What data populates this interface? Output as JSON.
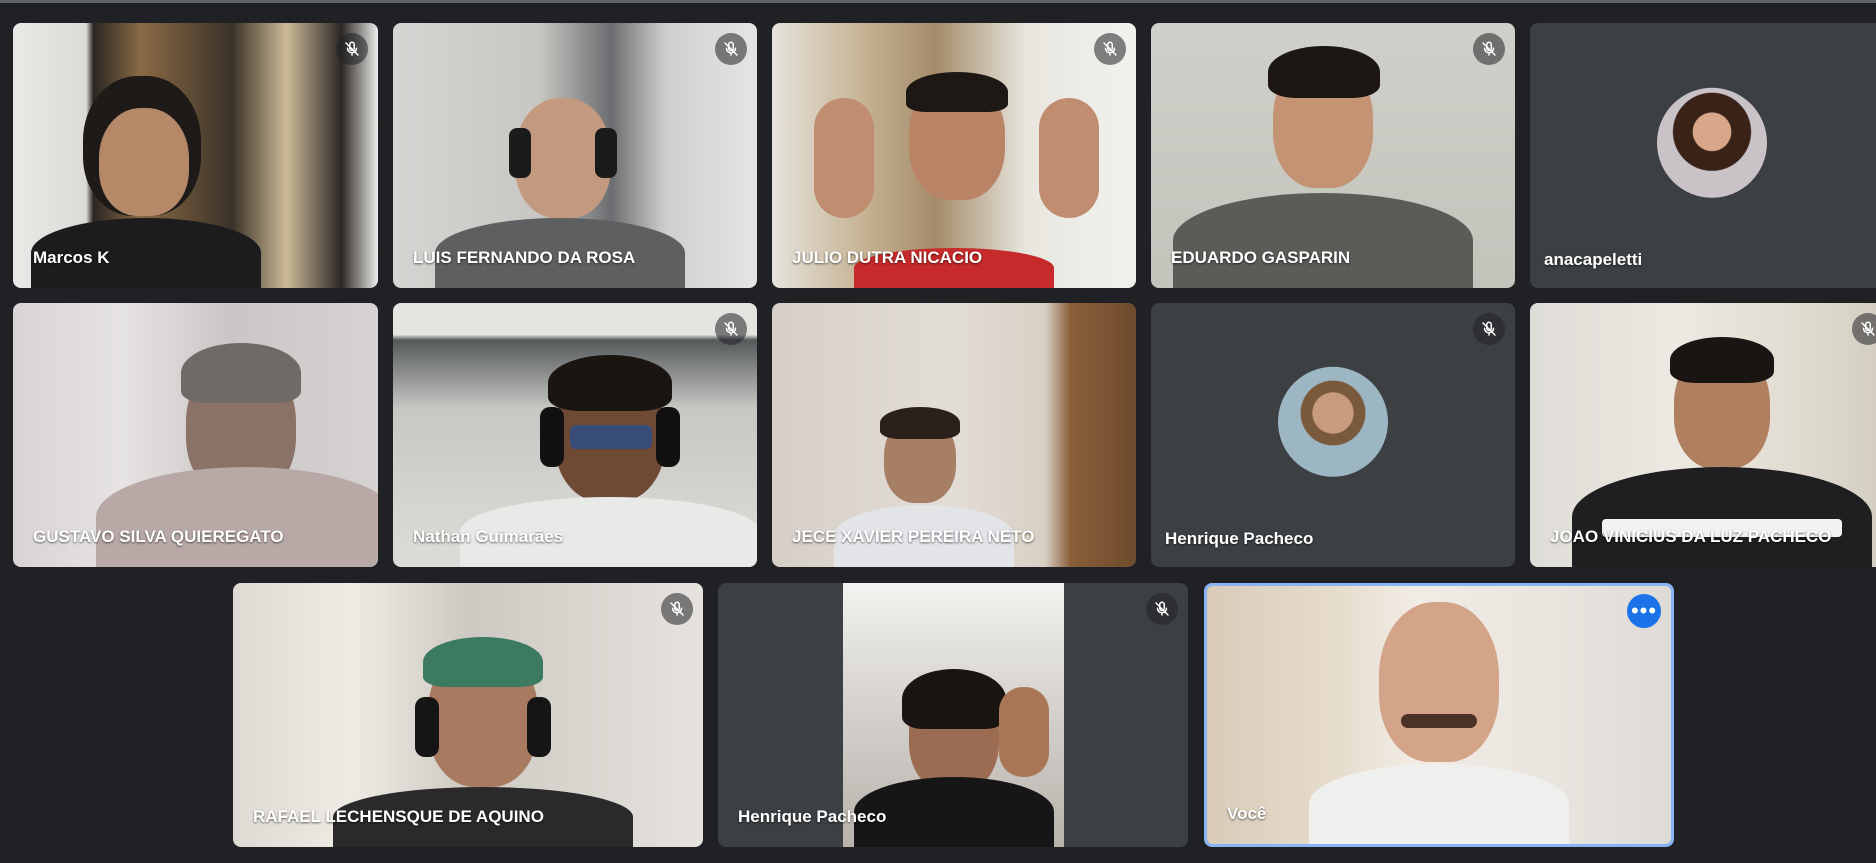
{
  "participants": [
    {
      "name": "Marcos K",
      "muted": true,
      "type": "video"
    },
    {
      "name": "LUIS FERNANDO DA ROSA",
      "muted": true,
      "type": "video"
    },
    {
      "name": "JULIO DUTRA NICACIO",
      "muted": true,
      "type": "video"
    },
    {
      "name": "EDUARDO GASPARIN",
      "muted": true,
      "type": "video"
    },
    {
      "name": "anacapeletti",
      "muted": false,
      "type": "avatar"
    },
    {
      "name": "GUSTAVO SILVA QUIEREGATO",
      "muted": false,
      "type": "video"
    },
    {
      "name": "Nathan Guimarães",
      "muted": true,
      "type": "video"
    },
    {
      "name": "JECE XAVIER PEREIRA NETO",
      "muted": false,
      "type": "video"
    },
    {
      "name": "Henrique Pacheco",
      "muted": true,
      "type": "avatar"
    },
    {
      "name": "JOAO VINICIUS DA LUZ PACHECO",
      "muted": true,
      "type": "video"
    },
    {
      "name": "RAFAEL LECHENSQUE DE AQUINO",
      "muted": true,
      "type": "video"
    },
    {
      "name": "Henrique Pacheco",
      "muted": true,
      "type": "video"
    },
    {
      "name": "Você",
      "muted": false,
      "type": "video",
      "self": true
    }
  ],
  "icons": {
    "mute": "mic-off-icon",
    "options": "more-options-icon"
  },
  "colors": {
    "background": "#202124",
    "tile": "#3c4043",
    "self_border": "#8ab4f8",
    "options_button": "#1a73e8"
  }
}
